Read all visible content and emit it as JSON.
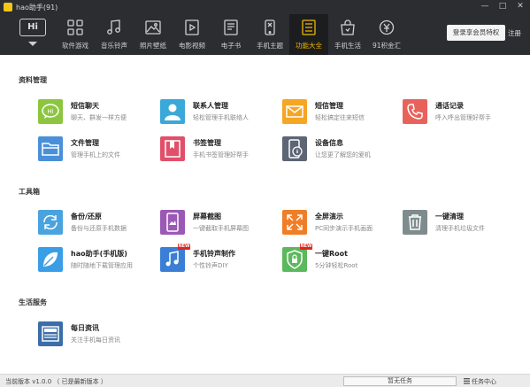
{
  "window": {
    "title": "hao助手(91)",
    "controls": [
      "—",
      "□",
      "✕"
    ]
  },
  "toolbar": {
    "home_label": "Hi",
    "nav": [
      {
        "label": "软件游戏",
        "icon": "apps-icon"
      },
      {
        "label": "音乐铃声",
        "icon": "music-icon"
      },
      {
        "label": "照片壁纸",
        "icon": "photo-icon"
      },
      {
        "label": "电影视频",
        "icon": "video-icon"
      },
      {
        "label": "电子书",
        "icon": "ebook-icon"
      },
      {
        "label": "手机主题",
        "icon": "theme-icon"
      },
      {
        "label": "功能大全",
        "icon": "features-icon",
        "active": true
      },
      {
        "label": "手机生活",
        "icon": "shopping-bag-icon"
      },
      {
        "label": "91积金汇",
        "icon": "finance-icon"
      }
    ],
    "vip_button": "登录享会员特权",
    "register_link": "注册"
  },
  "sections": [
    {
      "title": "资料管理",
      "items": [
        {
          "name": "短信聊天",
          "desc": "聊天、群发一样方便",
          "icon": "chat-bubble-icon",
          "color": "#8cc63f"
        },
        {
          "name": "联系人管理",
          "desc": "轻松管理手机联络人",
          "icon": "contact-icon",
          "color": "#3aa8d8"
        },
        {
          "name": "短信管理",
          "desc": "轻松搞定往来短信",
          "icon": "envelope-icon",
          "color": "#f5a623"
        },
        {
          "name": "通话记录",
          "desc": "呼入呼出管理好帮手",
          "icon": "phone-icon",
          "color": "#e8625b"
        },
        {
          "name": "文件管理",
          "desc": "管理手机上的文件",
          "icon": "folder-icon",
          "color": "#4a90d9"
        },
        {
          "name": "书签管理",
          "desc": "手机书签管理好帮手",
          "icon": "bookmark-icon",
          "color": "#e0506a"
        },
        {
          "name": "设备信息",
          "desc": "让您更了解您的爱机",
          "icon": "device-info-icon",
          "color": "#5c6674"
        }
      ]
    },
    {
      "title": "工具箱",
      "items": [
        {
          "name": "备份/还原",
          "desc": "备份与还原手机数据",
          "icon": "backup-restore-icon",
          "color": "#4aa3df"
        },
        {
          "name": "屏幕截图",
          "desc": "一键截取手机屏幕图",
          "icon": "screenshot-icon",
          "color": "#9b59b6"
        },
        {
          "name": "全屏演示",
          "desc": "PC同步演示手机画面",
          "icon": "fullscreen-icon",
          "color": "#f07e26"
        },
        {
          "name": "一键清理",
          "desc": "清理手机垃圾文件",
          "icon": "trash-icon",
          "color": "#7f8c8d"
        },
        {
          "name": "hao助手(手机版)",
          "desc": "随时随地下载管理应用",
          "icon": "leaf-icon",
          "color": "#3a9ee6"
        },
        {
          "name": "手机铃声制作",
          "desc": "个性铃声DIY",
          "icon": "music-note-icon",
          "color": "#3a7fd5",
          "badge": "NEW"
        },
        {
          "name": "一键Root",
          "desc": "5分钟轻松Root",
          "icon": "shield-lock-icon",
          "color": "#5cb85c",
          "badge": "NEW"
        }
      ]
    },
    {
      "title": "生活服务",
      "items": [
        {
          "name": "每日资讯",
          "desc": "关注手机每日资讯",
          "icon": "news-icon",
          "color": "#3b6ea8"
        }
      ]
    }
  ],
  "statusbar": {
    "version": "当前版本 v1.0.0 （ 已是最新版本 ）",
    "task_status": "暂无任务",
    "task_center": "任务中心"
  }
}
